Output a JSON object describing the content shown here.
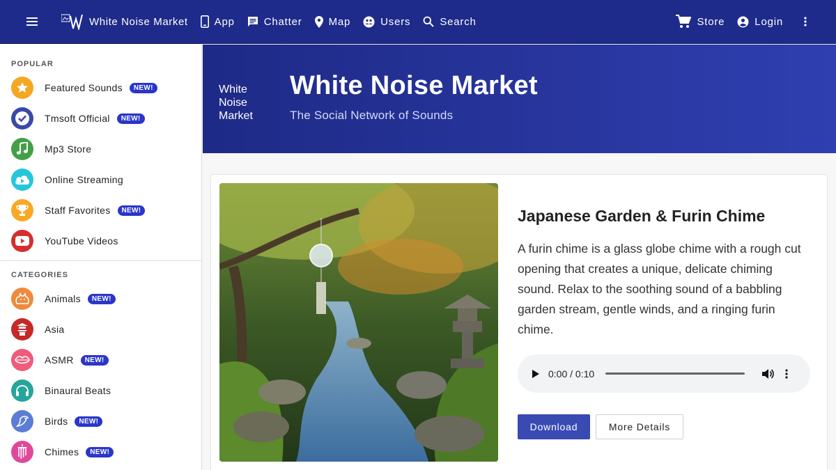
{
  "topbar": {
    "menu_icon": "hamburger-menu-icon",
    "brand_text": "White Noise Market",
    "nav": [
      {
        "label": "App",
        "icon": "phone-icon"
      },
      {
        "label": "Chatter",
        "icon": "chat-icon"
      },
      {
        "label": "Map",
        "icon": "map-pin-icon"
      },
      {
        "label": "Users",
        "icon": "users-globe-icon"
      },
      {
        "label": "Search",
        "icon": "search-icon"
      }
    ],
    "right_nav": [
      {
        "label": "Store",
        "icon": "cart-icon"
      },
      {
        "label": "Login",
        "icon": "account-icon"
      }
    ],
    "colors": {
      "bar": "#1e2b8a"
    }
  },
  "sidebar": {
    "popular_title": "POPULAR",
    "popular": [
      {
        "label": "Featured Sounds",
        "badge": "NEW!",
        "icon": "star-icon",
        "color": "#f5a623"
      },
      {
        "label": "Tmsoft Official",
        "badge": "NEW!",
        "icon": "check-circle-icon",
        "color": "#3949ab"
      },
      {
        "label": "Mp3 Store",
        "badge": "",
        "icon": "music-note-icon",
        "color": "#43a047"
      },
      {
        "label": "Online Streaming",
        "badge": "",
        "icon": "cloud-play-icon",
        "color": "#26c6da"
      },
      {
        "label": "Staff Favorites",
        "badge": "NEW!",
        "icon": "trophy-icon",
        "color": "#f9a825"
      },
      {
        "label": "YouTube Videos",
        "badge": "",
        "icon": "youtube-icon",
        "color": "#d32f2f"
      }
    ],
    "categories_title": "CATEGORIES",
    "categories": [
      {
        "label": "Animals",
        "badge": "NEW!",
        "icon": "cat-icon",
        "color": "#ef8a3c"
      },
      {
        "label": "Asia",
        "badge": "",
        "icon": "pagoda-icon",
        "color": "#c62828"
      },
      {
        "label": "ASMR",
        "badge": "NEW!",
        "icon": "lips-icon",
        "color": "#ef5b7b"
      },
      {
        "label": "Binaural Beats",
        "badge": "",
        "icon": "headphones-icon",
        "color": "#26a69a"
      },
      {
        "label": "Birds",
        "badge": "NEW!",
        "icon": "bird-icon",
        "color": "#5c7cd6"
      },
      {
        "label": "Chimes",
        "badge": "NEW!",
        "icon": "chime-icon",
        "color": "#e0489a"
      }
    ]
  },
  "hero": {
    "logo_alt": "White Noise Market",
    "title": "White Noise Market",
    "subtitle": "The Social Network of Sounds"
  },
  "card": {
    "title": "Japanese Garden & Furin Chime",
    "description": "A furin chime is a glass globe chime with a rough cut opening that creates a unique, delicate chiming sound. Relax to the soothing sound of a babbling garden stream, gentle winds, and a ringing furin chime.",
    "player": {
      "time": "0:00 / 0:10",
      "progress_fraction": 0
    },
    "download_label": "Download",
    "details_label": "More Details",
    "accent": "#3a4ab3"
  }
}
